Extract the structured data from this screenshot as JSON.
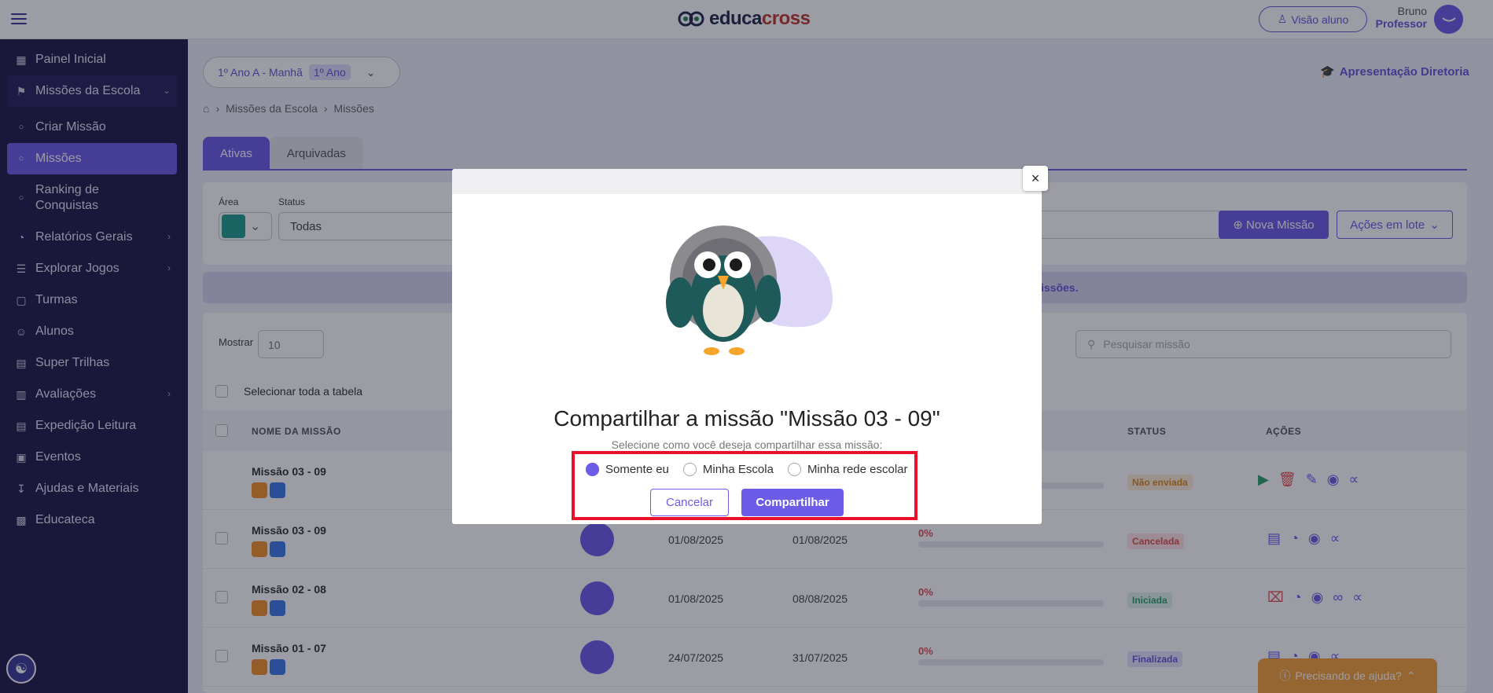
{
  "header": {
    "logo": [
      "educa",
      "cross"
    ],
    "visao_aluno": "Visão aluno",
    "user_name": "Bruno",
    "user_role": "Professor"
  },
  "sidebar": {
    "items": [
      {
        "label": "Painel Inicial",
        "icon": "grid-icon"
      },
      {
        "label": "Missões da Escola",
        "icon": "flag-icon"
      },
      {
        "label": "Criar Missão",
        "icon": "circle-icon"
      },
      {
        "label": "Missões",
        "icon": "circle-icon"
      },
      {
        "label": "Ranking de Conquistas",
        "icon": "circle-icon"
      },
      {
        "label": "Relatórios Gerais",
        "icon": "chart-icon"
      },
      {
        "label": "Explorar Jogos",
        "icon": "map-icon"
      },
      {
        "label": "Turmas",
        "icon": "briefcase-icon"
      },
      {
        "label": "Alunos",
        "icon": "users-icon"
      },
      {
        "label": "Super Trilhas",
        "icon": "book-icon"
      },
      {
        "label": "Avaliações",
        "icon": "test-icon"
      },
      {
        "label": "Expedição Leitura",
        "icon": "book-icon"
      },
      {
        "label": "Eventos",
        "icon": "calendar-icon"
      },
      {
        "label": "Ajudas e Materiais",
        "icon": "download-icon"
      },
      {
        "label": "Educateca",
        "icon": "monitor-icon"
      }
    ]
  },
  "class_select": {
    "label": "1º Ano A - Manhã",
    "badge": "1º Ano"
  },
  "dir_link": "Apresentação Diretoria",
  "breadcrumb": [
    "Missões da Escola",
    "Missões"
  ],
  "tabs": [
    "Ativas",
    "Arquivadas"
  ],
  "filters": {
    "area_label": "Área",
    "status_label": "Status",
    "status_value": "Todas",
    "nova_missao": "Nova Missão",
    "acoes_lote": "Ações em lote"
  },
  "info_text": "issões.",
  "table": {
    "mostrar": "Mostrar",
    "show_value": "10",
    "search_placeholder": "Pesquisar missão",
    "select_all": "Selecionar toda a tabela",
    "headers": {
      "name": "NOME DA MISSÃO",
      "status": "STATUS",
      "actions": "AÇÕES"
    },
    "rows": [
      {
        "name": "Missão 03 - 09",
        "start": "",
        "end": "",
        "progress": "",
        "status": "Não enviada"
      },
      {
        "name": "Missão 03 - 09",
        "start": "01/08/2025",
        "end": "01/08/2025",
        "progress": "0%",
        "status": "Cancelada"
      },
      {
        "name": "Missão 02 - 08",
        "start": "01/08/2025",
        "end": "08/08/2025",
        "progress": "0%",
        "status": "Iniciada"
      },
      {
        "name": "Missão 01 - 07",
        "start": "24/07/2025",
        "end": "31/07/2025",
        "progress": "0%",
        "status": "Finalizada"
      }
    ]
  },
  "help": "Precisando de ajuda?",
  "modal": {
    "title": "Compartilhar a missão \"Missão 03 - 09\"",
    "subtitle": "Selecione como você deseja compartilhar essa missão:",
    "options": [
      "Somente eu",
      "Minha Escola",
      "Minha rede escolar"
    ],
    "selected_option": "Somente eu",
    "cancel": "Cancelar",
    "share": "Compartilhar",
    "close": "×"
  }
}
